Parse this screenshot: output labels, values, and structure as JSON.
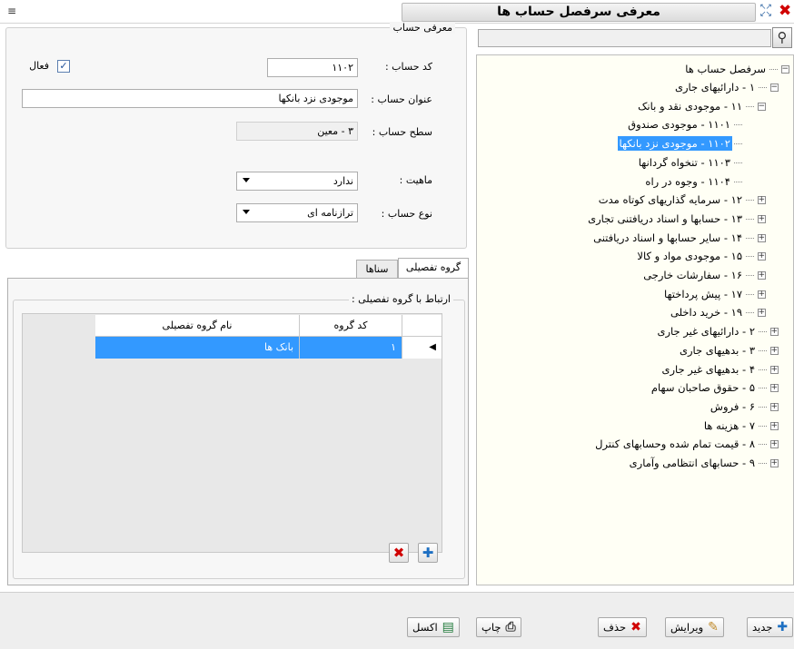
{
  "window": {
    "title": "معرفی سرفصل حساب ها",
    "menu_icon": "menu-icon",
    "close_icon": "close-icon",
    "expand_icon": "expand-icon"
  },
  "form": {
    "legend": "معرفی حساب",
    "code_label": "کد حساب :",
    "code_value": "۱۱۰۲",
    "active_label": "فعال",
    "active_checked": true,
    "title_label": "عنوان حساب :",
    "title_value": "موجودی نزد بانکها",
    "level_label": "سطح حساب :",
    "level_value": "۳ - معین",
    "nature_label": "ماهیت :",
    "nature_value": "ندارد",
    "type_label": "نوع حساب :",
    "type_value": "ترازنامه ای"
  },
  "tabs": [
    {
      "label": "گروه تفصیلی",
      "active": true
    },
    {
      "label": "سناها",
      "active": false
    }
  ],
  "detail_group": {
    "legend": "ارتباط با گروه تفصیلی :",
    "columns": [
      "کد گروه",
      "نام گروه تفصیلی"
    ],
    "rows": [
      {
        "code": "۱",
        "name": "بانک ها",
        "selected": true
      }
    ]
  },
  "tree": {
    "search_placeholder": "",
    "root": "سرفصل حساب ها",
    "items": [
      {
        "label": "۱ - دارائیهای جاری",
        "exp": "−"
      },
      {
        "label": "۱۱ - موجودی نقد و بانک",
        "exp": "−"
      },
      {
        "label": "۱۱۰۱ - موجودی صندوق",
        "exp": ""
      },
      {
        "label": "۱۱۰۲ - موجودی نزد بانکها",
        "exp": "",
        "selected": true
      },
      {
        "label": "۱۱۰۳ - تنخواه گردانها",
        "exp": ""
      },
      {
        "label": "۱۱۰۴ - وجوه در راه",
        "exp": ""
      },
      {
        "label": "۱۲ - سرمایه گذاریهای کوتاه مدت",
        "exp": "+"
      },
      {
        "label": "۱۳ - حسابها و اسناد دریافتنی تجاری",
        "exp": "+"
      },
      {
        "label": "۱۴ - سایر حسابها و اسناد دریافتنی",
        "exp": "+"
      },
      {
        "label": "۱۵ - موجودی مواد و کالا",
        "exp": "+"
      },
      {
        "label": "۱۶ - سفارشات خارجی",
        "exp": "+"
      },
      {
        "label": "۱۷ - پیش پرداختها",
        "exp": "+"
      },
      {
        "label": "۱۹ - خرید داخلی",
        "exp": "+"
      },
      {
        "label": "۲ - دارائیهای غیر جاری",
        "exp": "+"
      },
      {
        "label": "۳ - بدهیهای جاری",
        "exp": "+"
      },
      {
        "label": "۴ - بدهیهای غیر جاری",
        "exp": "+"
      },
      {
        "label": "۵ - حقوق صاحبان سهام",
        "exp": "+"
      },
      {
        "label": "۶ - فروش",
        "exp": "+"
      },
      {
        "label": "۷ - هزینه ها",
        "exp": "+"
      },
      {
        "label": "۸ - قیمت تمام شده وحسابهای کنترل",
        "exp": "+"
      },
      {
        "label": "۹ - حسابهای انتظامی وآماری",
        "exp": "+"
      }
    ]
  },
  "toolbar": {
    "new_label": "جدید",
    "edit_label": "ویرایش",
    "delete_label": "حذف",
    "print_label": "چاپ",
    "excel_label": "اکسل"
  },
  "colors": {
    "selection": "#3399ff",
    "tree_background": "#fffff5",
    "delete_red": "#d00000"
  }
}
